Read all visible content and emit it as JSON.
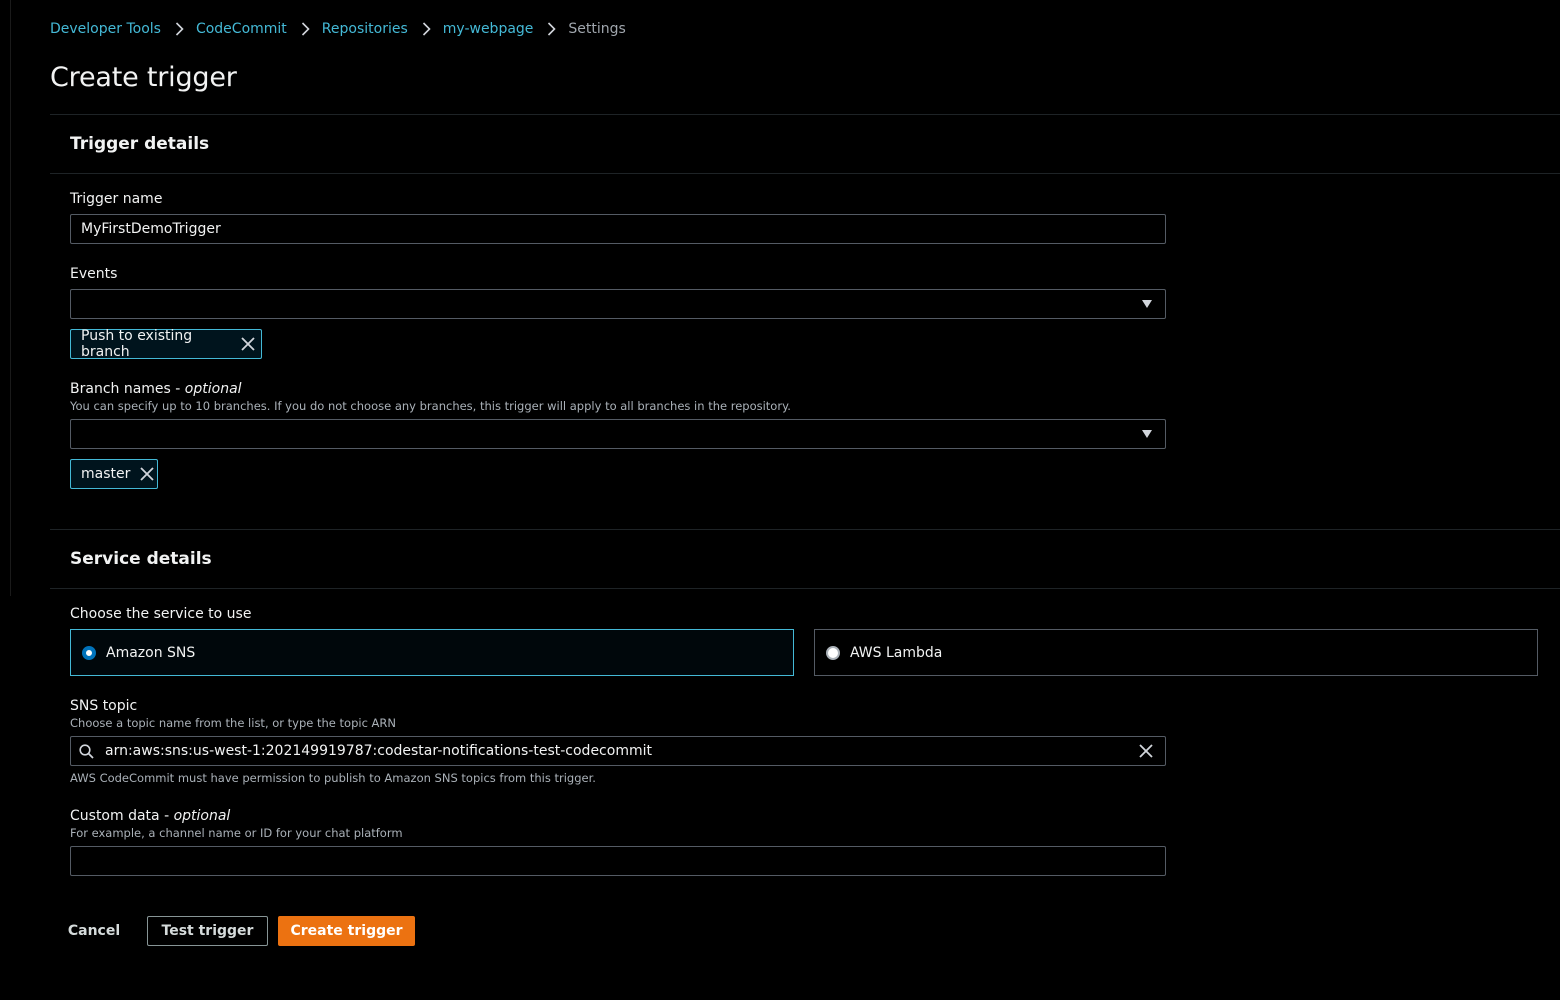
{
  "breadcrumb": {
    "items": [
      {
        "label": "Developer Tools"
      },
      {
        "label": "CodeCommit"
      },
      {
        "label": "Repositories"
      },
      {
        "label": "my-webpage"
      },
      {
        "label": "Settings"
      }
    ]
  },
  "page": {
    "title": "Create trigger"
  },
  "trigger_details": {
    "title": "Trigger details",
    "trigger_name_label": "Trigger name",
    "trigger_name_value": "MyFirstDemoTrigger",
    "events_label": "Events",
    "events_value": "",
    "events_tokens": [
      "Push to existing branch"
    ],
    "branch_names_label": "Branch names - ",
    "branch_names_optional": "optional",
    "branch_names_desc": "You can specify up to 10 branches. If you do not choose any branches, this trigger will apply to all branches in the repository.",
    "branch_names_value": "",
    "branch_tokens": [
      "master"
    ]
  },
  "service_details": {
    "title": "Service details",
    "choose_label": "Choose the service to use",
    "options": [
      {
        "label": "Amazon SNS",
        "selected": true
      },
      {
        "label": "AWS Lambda",
        "selected": false
      }
    ],
    "sns_topic_label": "SNS topic",
    "sns_topic_desc": "Choose a topic name from the list, or type the topic ARN",
    "sns_topic_value": "arn:aws:sns:us-west-1:202149919787:codestar-notifications-test-codecommit",
    "sns_topic_hint": "AWS CodeCommit must have permission to publish to Amazon SNS topics from this trigger.",
    "custom_data_label": "Custom data - ",
    "custom_data_optional": "optional",
    "custom_data_desc": "For example, a channel name or ID for your chat platform",
    "custom_data_value": ""
  },
  "actions": {
    "cancel": "Cancel",
    "test": "Test trigger",
    "create": "Create trigger"
  },
  "colors": {
    "link": "#44b9d6",
    "primary": "#ec7211",
    "background": "#000000",
    "radio_selected": "#0073bb"
  }
}
